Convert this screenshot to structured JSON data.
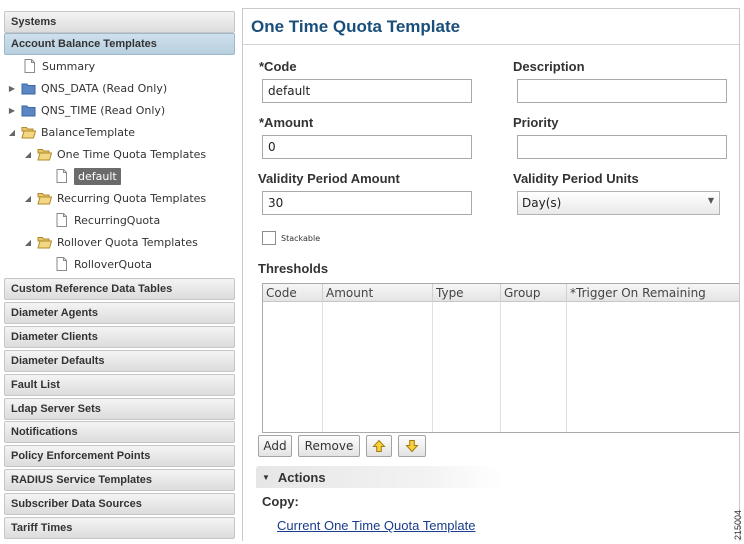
{
  "nav": {
    "top_headers": [
      "Systems",
      "Account Balance Templates"
    ],
    "tree": [
      {
        "label": "Summary",
        "icon": "page-icon"
      },
      {
        "label": "QNS_DATA (Read Only)",
        "icon": "folder-closed-icon"
      },
      {
        "label": "QNS_TIME (Read Only)",
        "icon": "folder-closed-icon"
      },
      {
        "label": "BalanceTemplate",
        "icon": "folder-open-icon"
      },
      {
        "label": "One Time Quota Templates",
        "icon": "folder-open-icon"
      },
      {
        "label": "default",
        "icon": "page-icon",
        "selected": true
      },
      {
        "label": "Recurring Quota Templates",
        "icon": "folder-open-icon"
      },
      {
        "label": "RecurringQuota",
        "icon": "page-icon"
      },
      {
        "label": "Rollover Quota Templates",
        "icon": "folder-open-icon"
      },
      {
        "label": "RolloverQuota",
        "icon": "page-icon"
      }
    ],
    "bottom_headers": [
      "Custom Reference Data Tables",
      "Diameter Agents",
      "Diameter Clients",
      "Diameter Defaults",
      "Fault List",
      "Ldap Server Sets",
      "Notifications",
      "Policy Enforcement Points",
      "RADIUS Service Templates",
      "Subscriber Data Sources",
      "Tariff Times"
    ]
  },
  "form": {
    "title": "One Time Quota Template",
    "code_label": "*Code",
    "code_value": "default",
    "description_label": "Description",
    "description_value": "",
    "amount_label": "*Amount",
    "amount_value": "0",
    "priority_label": "Priority",
    "priority_value": "",
    "validity_amount_label": "Validity Period Amount",
    "validity_amount_value": "30",
    "validity_units_label": "Validity Period Units",
    "validity_units_value": "Day(s)",
    "stackable_label": "Stackable",
    "stackable_checked": false
  },
  "thresholds": {
    "label": "Thresholds",
    "columns": [
      "Code",
      "Amount",
      "Type",
      "Group",
      "*Trigger On Remaining"
    ],
    "rows": []
  },
  "buttons": {
    "add": "Add",
    "remove": "Remove"
  },
  "actions": {
    "header": "Actions",
    "copy_label": "Copy:",
    "copy_link": "Current One Time Quota Template"
  },
  "figure_number": "215004"
}
